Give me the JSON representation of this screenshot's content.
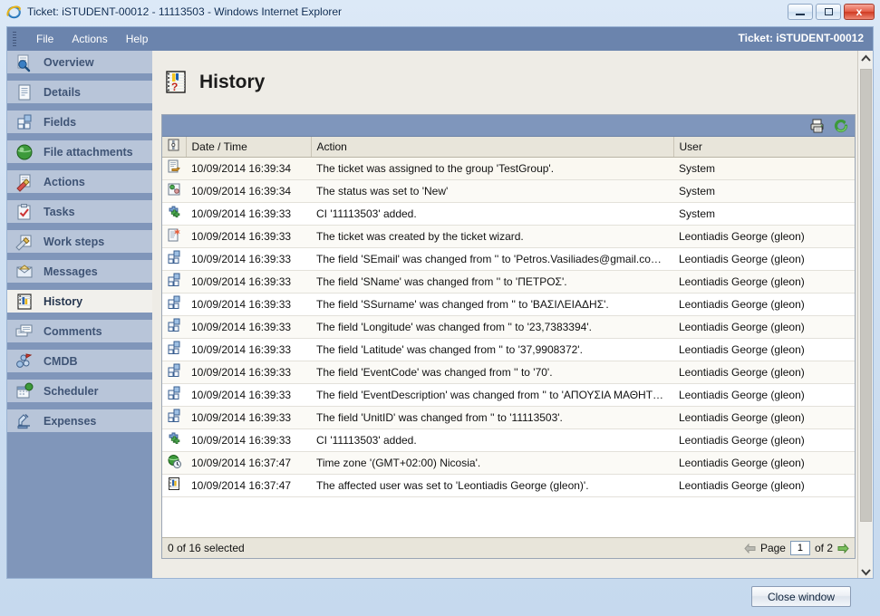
{
  "window": {
    "title": "Ticket: iSTUDENT-00012 - 11113503 - Windows Internet Explorer",
    "browser_icon": "internet-explorer-icon",
    "minimize_label": "Minimize",
    "maximize_label": "Maximize",
    "close_label": "x"
  },
  "menu": {
    "items": [
      "File",
      "Actions",
      "Help"
    ],
    "ticket_label": "Ticket: iSTUDENT-00012"
  },
  "sidebar": {
    "items": [
      {
        "label": "Overview",
        "icon": "overview-icon",
        "active": false
      },
      {
        "label": "Details",
        "icon": "details-icon",
        "active": false
      },
      {
        "label": "Fields",
        "icon": "fields-icon",
        "active": false
      },
      {
        "label": "File attachments",
        "icon": "attachment-icon",
        "active": false
      },
      {
        "label": "Actions",
        "icon": "actions-icon",
        "active": false
      },
      {
        "label": "Tasks",
        "icon": "tasks-icon",
        "active": false
      },
      {
        "label": "Work steps",
        "icon": "worksteps-icon",
        "active": false
      },
      {
        "label": "Messages",
        "icon": "messages-icon",
        "active": false
      },
      {
        "label": "History",
        "icon": "history-icon",
        "active": true
      },
      {
        "label": "Comments",
        "icon": "comments-icon",
        "active": false
      },
      {
        "label": "CMDB",
        "icon": "cmdb-icon",
        "active": false
      },
      {
        "label": "Scheduler",
        "icon": "scheduler-icon",
        "active": false
      },
      {
        "label": "Expenses",
        "icon": "expenses-icon",
        "active": false
      }
    ]
  },
  "page": {
    "title": "History",
    "icon": "history-page-icon"
  },
  "toolbar": {
    "print_icon": "printer-icon",
    "refresh_icon": "refresh-icon"
  },
  "grid": {
    "columns": [
      "",
      "Date / Time",
      "Action",
      "User"
    ],
    "rows": [
      {
        "icon": "assign-icon",
        "date": "10/09/2014 16:39:34",
        "action": "The ticket was assigned to the group 'TestGroup'.",
        "user": "System"
      },
      {
        "icon": "status-icon",
        "date": "10/09/2014 16:39:34",
        "action": "The status was set to 'New'",
        "user": "System"
      },
      {
        "icon": "ci-add-icon",
        "date": "10/09/2014 16:39:33",
        "action": "CI '11113503' added.",
        "user": "System"
      },
      {
        "icon": "new-doc-icon",
        "date": "10/09/2014 16:39:33",
        "action": "The ticket was created by the ticket wizard.",
        "user": "Leontiadis George (gleon)"
      },
      {
        "icon": "field-icon",
        "date": "10/09/2014 16:39:33",
        "action": "The field 'SEmail' was changed from '' to 'Petros.Vasiliades@gmail.co…",
        "user": "Leontiadis George (gleon)"
      },
      {
        "icon": "field-icon",
        "date": "10/09/2014 16:39:33",
        "action": "The field 'SName' was changed from '' to 'ΠΕΤΡΟΣ'.",
        "user": "Leontiadis George (gleon)"
      },
      {
        "icon": "field-icon",
        "date": "10/09/2014 16:39:33",
        "action": "The field 'SSurname' was changed from '' to 'ΒΑΣΙΛΕΙΑΔΗΣ'.",
        "user": "Leontiadis George (gleon)"
      },
      {
        "icon": "field-icon",
        "date": "10/09/2014 16:39:33",
        "action": "The field 'Longitude' was changed from '' to '23,7383394'.",
        "user": "Leontiadis George (gleon)"
      },
      {
        "icon": "field-icon",
        "date": "10/09/2014 16:39:33",
        "action": "The field 'Latitude' was changed from '' to '37,9908372'.",
        "user": "Leontiadis George (gleon)"
      },
      {
        "icon": "field-icon",
        "date": "10/09/2014 16:39:33",
        "action": "The field 'EventCode' was changed from '' to '70'.",
        "user": "Leontiadis George (gleon)"
      },
      {
        "icon": "field-icon",
        "date": "10/09/2014 16:39:33",
        "action": "The field 'EventDescription' was changed from '' to 'ΑΠΟΥΣΙΑ ΜΑΘΗΤ…",
        "user": "Leontiadis George (gleon)"
      },
      {
        "icon": "field-icon",
        "date": "10/09/2014 16:39:33",
        "action": "The field 'UnitID' was changed from '' to '11113503'.",
        "user": "Leontiadis George (gleon)"
      },
      {
        "icon": "ci-add-icon",
        "date": "10/09/2014 16:39:33",
        "action": "CI '11113503' added.",
        "user": "Leontiadis George (gleon)"
      },
      {
        "icon": "timezone-icon",
        "date": "10/09/2014 16:37:47",
        "action": "Time zone '(GMT+02:00) Nicosia'.",
        "user": "Leontiadis George (gleon)"
      },
      {
        "icon": "user-set-icon",
        "date": "10/09/2014 16:37:47",
        "action": "The affected user was set to 'Leontiadis George (gleon)'.",
        "user": "Leontiadis George (gleon)"
      }
    ],
    "status_text": "0 of 16 selected",
    "pager": {
      "prev_icon": "arrow-left-icon",
      "page_label": "Page",
      "page_value": "1",
      "of_label": "of 2",
      "next_icon": "arrow-right-icon"
    }
  },
  "footer": {
    "close_window_label": "Close window"
  },
  "scrollbar": {
    "up_icon": "chevron-up-icon",
    "down_icon": "chevron-down-icon"
  },
  "colors": {
    "menu_blue": "#6b84ad",
    "sidebar_blue": "#8096ba",
    "nav_item": "#b8c5d9",
    "nav_active": "#f1f0ec",
    "grid_header": "#e8e5da",
    "toolbar_blue": "#7f96bc"
  }
}
